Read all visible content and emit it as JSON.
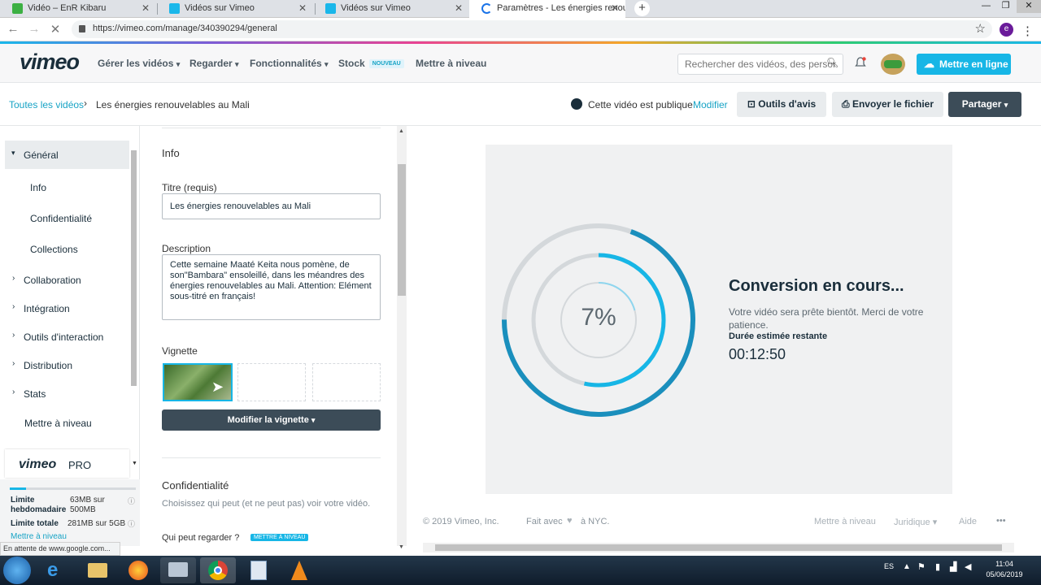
{
  "browser": {
    "tabs": [
      {
        "title": "Vidéo – EnR Kibaru",
        "favicon_color": "#3cb043"
      },
      {
        "title": "Vidéos sur Vimeo",
        "favicon_color": "#1ab7ea"
      },
      {
        "title": "Vidéos sur Vimeo",
        "favicon_color": "#1ab7ea"
      },
      {
        "title": "Paramètres - Les énergies renou",
        "favicon_color": "#1a73e8"
      }
    ],
    "new_tab": "+",
    "url": "https://vimeo.com/manage/340390294/general",
    "avatar_letter": "e",
    "status_text": "En attente de www.google.com..."
  },
  "header": {
    "logo": "vimeo",
    "nav": [
      "Gérer les vidéos",
      "Regarder",
      "Fonctionnalités"
    ],
    "stock": "Stock",
    "stock_badge": "NOUVEAU",
    "upgrade": "Mettre à niveau",
    "search_placeholder": "Rechercher des vidéos, des personnes",
    "upload_button": "Mettre en ligne"
  },
  "subheader": {
    "breadcrumb_root": "Toutes les vidéos",
    "breadcrumb_current": "Les énergies renouvelables au Mali",
    "visibility_text": "Cette vidéo est publique",
    "modify_link": "Modifier",
    "review_tools": "Outils d'avis",
    "send_file": "Envoyer le fichier",
    "share": "Partager"
  },
  "sidebar": {
    "general": "Général",
    "sub_items": [
      "Info",
      "Confidentialité",
      "Collections"
    ],
    "items": [
      "Collaboration",
      "Intégration",
      "Outils d'interaction",
      "Distribution",
      "Stats"
    ],
    "upgrade": "Mettre à niveau",
    "pro_logo": "vimeo",
    "pro_suffix": "PRO",
    "quota": {
      "weekly_label": "Limite hebdomadaire",
      "weekly_value": "63MB sur 500MB",
      "total_label": "Limite totale",
      "total_value": "281MB sur 5GB",
      "upgrade_link": "Mettre à niveau"
    }
  },
  "form": {
    "section_title": "Info",
    "title_label": "Titre (requis)",
    "title_value": "Les énergies renouvelables au Mali",
    "description_label": "Description",
    "description_value": "Cette semaine Maaté Keita nous pomène, de son\"Bambara\" ensoleillé, dans les méandres des énergies renouvelables au Mali. Attention: Elément sous-titré en français!",
    "thumbnail_label": "Vignette",
    "thumbnail_button": "Modifier la vignette",
    "privacy_title": "Confidentialité",
    "privacy_desc": "Choisissez qui peut (et ne peut pas) voir votre vidéo.",
    "who_can_watch": "Qui peut regarder ?",
    "upgrade_badge": "METTRE À NIVEAU"
  },
  "conversion": {
    "percent_label": "7%",
    "progress": 0.07,
    "title": "Conversion en cours...",
    "message": "Votre vidéo sera prête bientôt. Merci de votre patience.",
    "estimate_label": "Durée estimée restante",
    "estimate_time": "00:12:50",
    "colors": {
      "ring_blue": "#1a8fbd",
      "ring_light": "#17b6e6",
      "ring_gray": "#d4d8db"
    }
  },
  "footer": {
    "copyright": "© 2019 Vimeo, Inc.",
    "made_with": "Fait avec",
    "made_in": "à NYC.",
    "upgrade": "Mettre à niveau",
    "legal": "Juridique",
    "help": "Aide",
    "more": "•••"
  },
  "taskbar": {
    "lang": "ES",
    "time": "11:04",
    "date": "05/06/2019"
  }
}
